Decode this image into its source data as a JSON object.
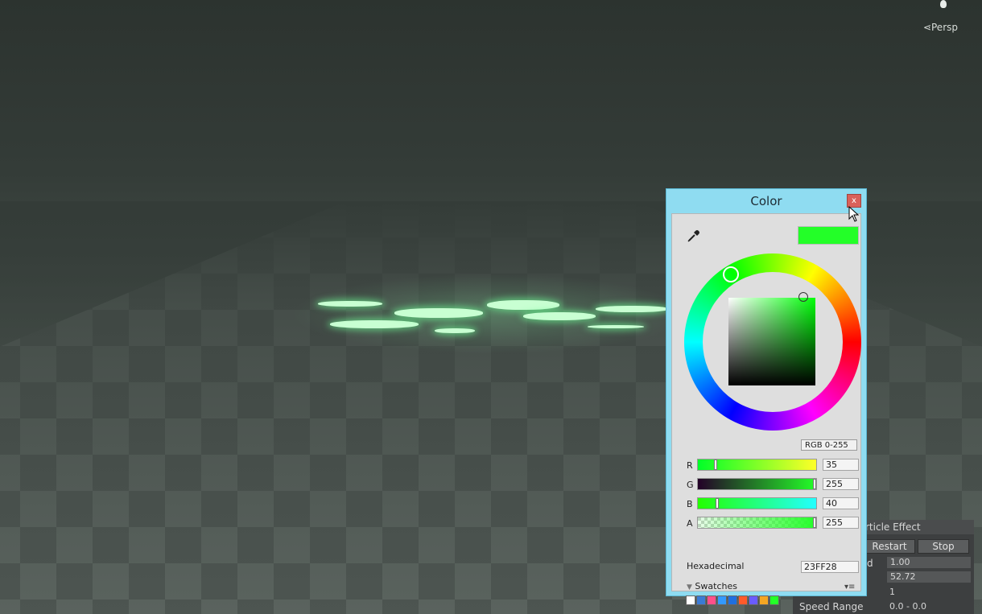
{
  "scene": {
    "view_label": "Persp"
  },
  "inspector": {
    "header": "rticle Effect",
    "restart_label": "Restart",
    "stop_label": "Stop",
    "rows": [
      {
        "label": "d",
        "value": "1.00"
      },
      {
        "label": "",
        "value": "52.72"
      },
      {
        "label": "",
        "value": "1"
      },
      {
        "label": "Speed Range",
        "value": "0.0 - 0.0"
      }
    ]
  },
  "color_window": {
    "title": "Color",
    "close_label": "x",
    "current_color": "#23FF28",
    "mode_label": "RGB 0-255",
    "channels": [
      {
        "label": "R",
        "value": "35"
      },
      {
        "label": "G",
        "value": "255"
      },
      {
        "label": "B",
        "value": "40"
      },
      {
        "label": "A",
        "value": "255"
      }
    ],
    "hex_label": "Hexadecimal",
    "hex_value": "23FF28",
    "swatches_label": "Swatches",
    "swatch_colors": [
      "#ffffff",
      "#3a7bd5",
      "#ff4f8b",
      "#3399ff",
      "#1f6fe0",
      "#ff5a2a",
      "#6a5cff",
      "#f5a623",
      "#23ff28"
    ]
  }
}
